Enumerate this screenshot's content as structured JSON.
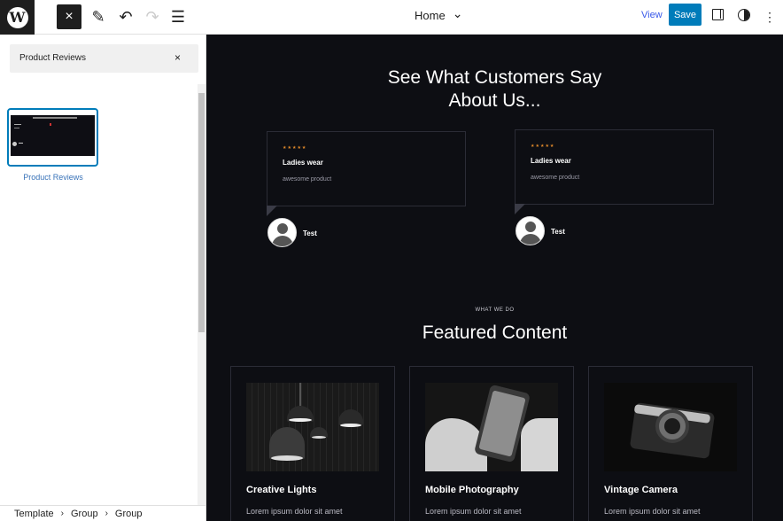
{
  "header": {
    "logo_letter": "W",
    "close_icon": "×",
    "edit_icon": "✎",
    "undo_icon": "↶",
    "redo_icon": "↷",
    "list_view_icon": "☰",
    "document_title": "Home",
    "dropdown_icon": "⌄",
    "view_label": "View",
    "save_label": "Save",
    "more_icon": "⋮",
    "accent_color": "#007cba"
  },
  "sidebar": {
    "search_value": "Product Reviews",
    "clear_icon": "×",
    "pattern": {
      "label": "Product Reviews"
    }
  },
  "breadcrumb": {
    "items": [
      "Template",
      "Group",
      "Group"
    ],
    "separator": "›"
  },
  "canvas": {
    "testimonials": {
      "heading_line1": "See What Customers Say",
      "heading_line2": "About Us...",
      "reviews": [
        {
          "stars": "★★★★★",
          "title": "Ladies wear",
          "text": "awesome product",
          "author": "Test"
        },
        {
          "stars": "★★★★★",
          "title": "Ladies wear",
          "text": "awesome product",
          "author": "Test"
        }
      ]
    },
    "features": {
      "eyebrow": "WHAT WE DO",
      "heading": "Featured Content",
      "cards": [
        {
          "title": "Creative Lights",
          "text": "Lorem ipsum dolor sit amet"
        },
        {
          "title": "Mobile Photography",
          "text": "Lorem ipsum dolor sit amet"
        },
        {
          "title": "Vintage Camera",
          "text": "Lorem ipsum dolor sit amet"
        }
      ]
    }
  }
}
